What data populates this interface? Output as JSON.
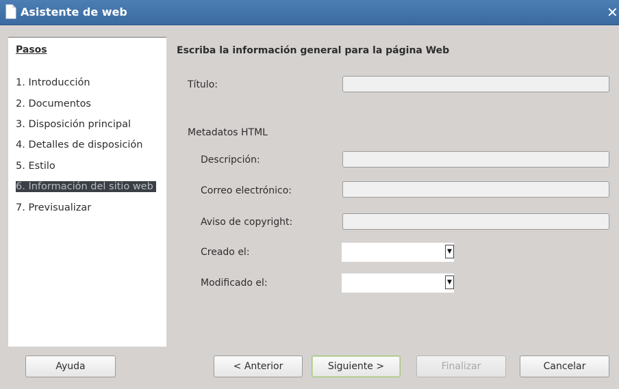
{
  "window": {
    "title": "Asistente de web",
    "close_glyph": "✕"
  },
  "steps": {
    "heading": "Pasos",
    "items": [
      {
        "label": "1. Introducción",
        "active": false
      },
      {
        "label": "2. Documentos",
        "active": false
      },
      {
        "label": "3. Disposición principal",
        "active": false
      },
      {
        "label": "4. Detalles de disposición",
        "active": false
      },
      {
        "label": "5. Estilo",
        "active": false
      },
      {
        "label": "6. Información del sitio web",
        "active": true
      },
      {
        "label": "7. Previsualizar",
        "active": false
      }
    ]
  },
  "form": {
    "heading": "Escriba la información general para la página Web",
    "title_label": "Título:",
    "title_value": "",
    "metadata_heading": "Metadatos HTML",
    "description_label": "Descripción:",
    "description_value": "",
    "email_label": "Correo electrónico:",
    "email_value": "",
    "copyright_label": "Aviso de copyright:",
    "copyright_value": "",
    "created_label": "Creado el:",
    "created_value": "",
    "modified_label": "Modificado el:",
    "modified_value": ""
  },
  "buttons": {
    "help": "Ayuda",
    "previous": "< Anterior",
    "next": "Siguiente >",
    "finish": "Finalizar",
    "cancel": "Cancelar"
  },
  "icons": {
    "window_icon": "document-icon",
    "close": "close-icon",
    "dropdown": "chevron-down-icon"
  },
  "colors": {
    "titlebar": "#3f71a8",
    "selection_bg": "#3b3f45",
    "dialog_bg": "#d6d2d0"
  }
}
